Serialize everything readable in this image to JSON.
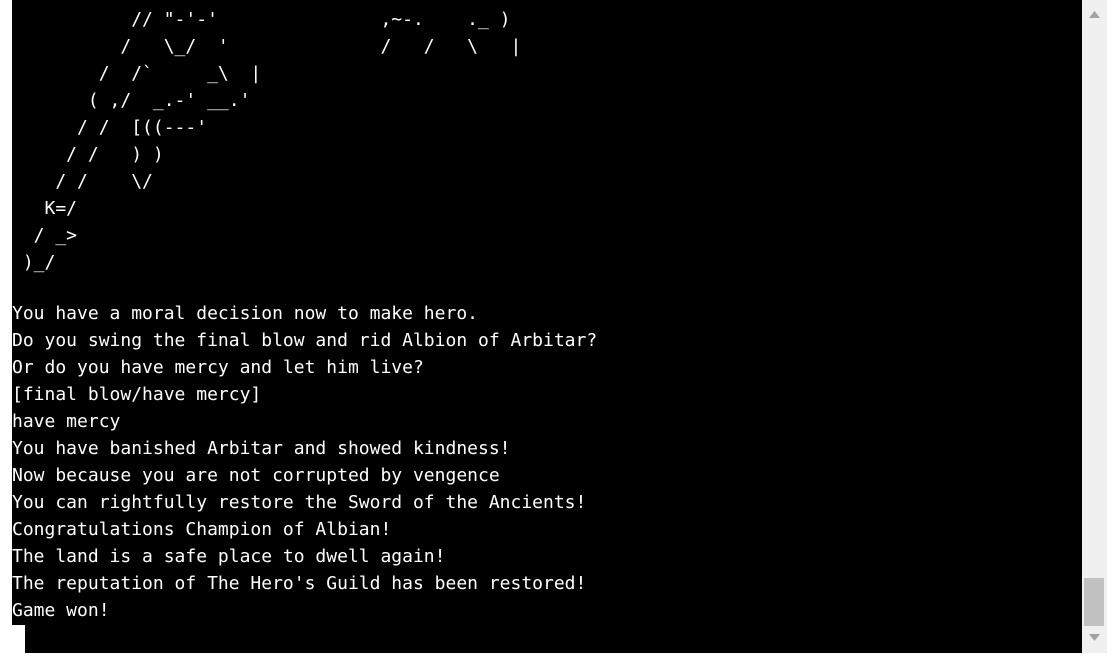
{
  "terminal": {
    "ascii_art": "           // \"-'-'               ,~-.    ._ )\n          /   \\_/  '              /   /   \\   |\n        /  /`     _\\  |\n       ( ,/  _.-' __.'\n      / /  [((---'\n     / /   ) )\n    / /    \\/\n   K=/\n  / _>\n )_/",
    "lines": [
      "You have a moral decision now to make hero.",
      "Do you swing the final blow and rid Albion of Arbitar?",
      "Or do you have mercy and let him live?",
      "[final blow/have mercy]",
      "have mercy",
      "You have banished Arbitar and showed kindness!",
      "Now because you are not corrupted by vengence",
      "You can rightfully restore the Sword of the Ancients!",
      "Congratulations Champion of Albian!",
      "The land is a safe place to dwell again!",
      "The reputation of The Hero's Guild has been restored!",
      "Game won!"
    ]
  },
  "scrollbar": {
    "up_icon": "triangle-up",
    "down_icon": "triangle-down",
    "position": 0.97
  },
  "colors": {
    "terminal_bg": "#000000",
    "terminal_fg": "#ffffff",
    "scrollbar_track": "#f0f0f0",
    "scrollbar_thumb": "#c1c1c1",
    "arrow": "#a3a3a3"
  }
}
